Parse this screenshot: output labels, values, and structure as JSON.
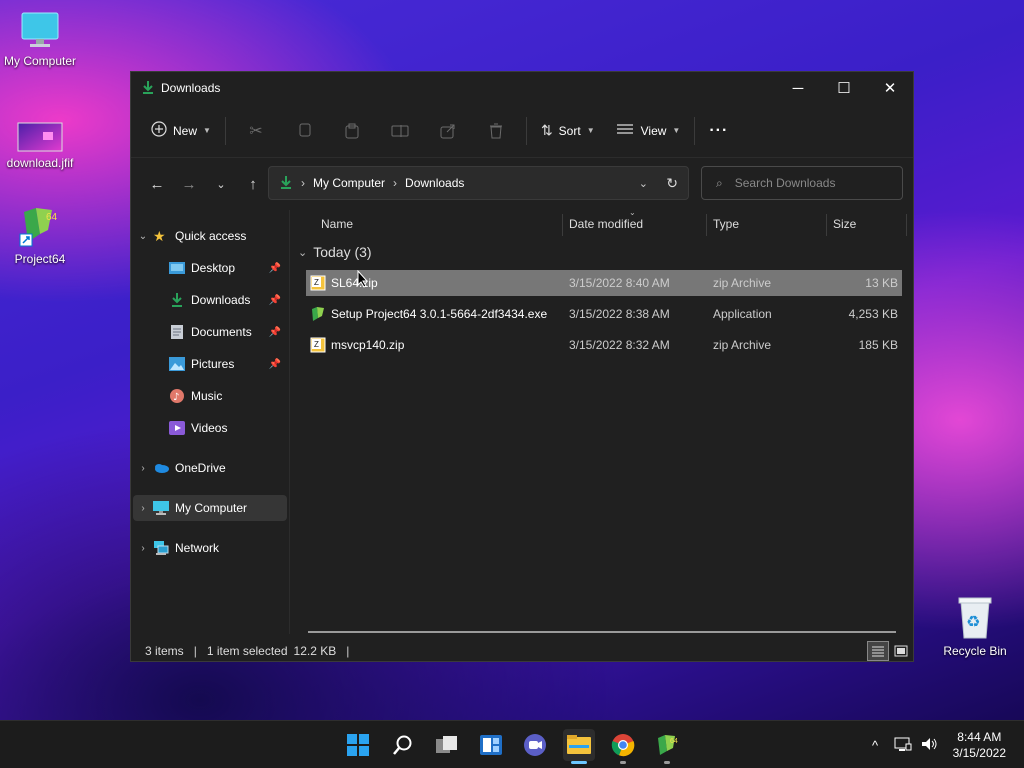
{
  "desktop": {
    "icons": [
      {
        "label": "My Computer"
      },
      {
        "label": "download.jfif"
      },
      {
        "label": "Project64"
      },
      {
        "label": "Recycle Bin"
      }
    ]
  },
  "window": {
    "title": "Downloads",
    "controls": {
      "minimize": "─",
      "maximize": "☐",
      "close": "✕"
    }
  },
  "toolbar": {
    "new_label": "New",
    "sort_label": "Sort",
    "view_label": "View",
    "more_label": "···"
  },
  "address": {
    "crumbs": [
      "My Computer",
      "Downloads"
    ],
    "separator": "›"
  },
  "search": {
    "placeholder": "Search Downloads"
  },
  "sidebar": {
    "quick_access": "Quick access",
    "items": [
      {
        "label": "Desktop",
        "pinned": true
      },
      {
        "label": "Downloads",
        "pinned": true
      },
      {
        "label": "Documents",
        "pinned": true
      },
      {
        "label": "Pictures",
        "pinned": true
      },
      {
        "label": "Music",
        "pinned": false
      },
      {
        "label": "Videos",
        "pinned": false
      }
    ],
    "onedrive": "OneDrive",
    "my_computer": "My Computer",
    "network": "Network"
  },
  "columns": {
    "name": "Name",
    "date": "Date modified",
    "type": "Type",
    "size": "Size"
  },
  "group": {
    "label": "Today (3)"
  },
  "files": [
    {
      "name": "SL64.zip",
      "date": "3/15/2022 8:40 AM",
      "type": "zip Archive",
      "size": "13 KB",
      "icon": "zip-icon",
      "selected": true
    },
    {
      "name": "Setup Project64 3.0.1-5664-2df3434.exe",
      "date": "3/15/2022 8:38 AM",
      "type": "Application",
      "size": "4,253 KB",
      "icon": "project64-icon",
      "selected": false
    },
    {
      "name": "msvcp140.zip",
      "date": "3/15/2022 8:32 AM",
      "type": "zip Archive",
      "size": "185 KB",
      "icon": "zip-icon",
      "selected": false
    }
  ],
  "status": {
    "items": "3 items",
    "selected": "1 item selected",
    "size": "12.2 KB",
    "sep": "|"
  },
  "taskbar": {
    "time": "8:44 AM",
    "date": "3/15/2022",
    "tray_chevron": "^"
  },
  "colors": {
    "window_bg": "#202020",
    "selected_row": "#777777",
    "accent_green": "#29a35a",
    "folder_yellow": "#f4c33c"
  }
}
